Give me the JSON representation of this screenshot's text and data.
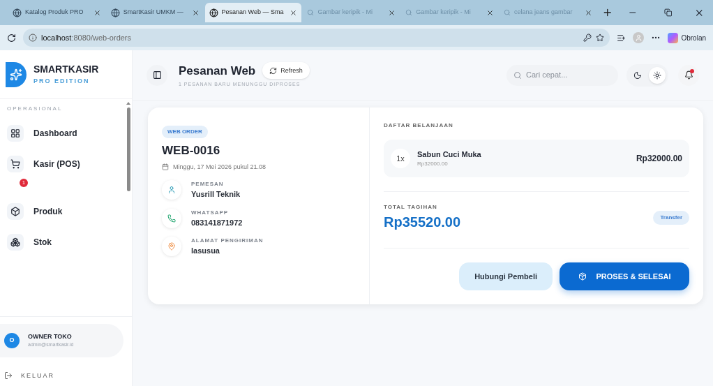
{
  "browser": {
    "tabs": [
      {
        "title": "Katalog Produk PRO",
        "selected": false,
        "kind": "globe"
      },
      {
        "title": "SmartKasir UMKM —",
        "selected": false,
        "kind": "globe"
      },
      {
        "title": "Pesanan Web — Sma",
        "selected": true,
        "kind": "globe"
      },
      {
        "title": "Gambar keripik - Mi",
        "selected": false,
        "kind": "search"
      },
      {
        "title": "Gambar keripik - Mi",
        "selected": false,
        "kind": "search"
      },
      {
        "title": "celana jeans gambar",
        "selected": false,
        "kind": "search"
      }
    ],
    "address_host": "localhost",
    "address_rest": ":8080/web-orders",
    "copilot_label": "Obrolan"
  },
  "sidebar": {
    "brand": "SMARTKASIR",
    "edition": "PRO EDITION",
    "section": "OPERASIONAL",
    "items": [
      {
        "label": "Dashboard"
      },
      {
        "label": "Kasir (POS)",
        "badge": "1"
      },
      {
        "label": "Produk"
      },
      {
        "label": "Stok"
      }
    ],
    "user": {
      "initial": "O",
      "name": "OWNER TOKO",
      "email": "admin@smartkasir.id"
    },
    "logout": "KELUAR"
  },
  "header": {
    "title": "Pesanan Web",
    "refresh": "Refresh",
    "subtitle": "1 PESANAN BARU MENUNGGU DIPROSES",
    "search_placeholder": "Cari cepat...",
    "theme_options": [
      {
        "kind": "dark",
        "selected": false
      },
      {
        "kind": "light",
        "selected": true
      }
    ],
    "notification_alert": true
  },
  "order": {
    "tag": "WEB ORDER",
    "id": "WEB-0016",
    "date": "Minggu, 17 Mei 2026 pukul 21.08",
    "fields": [
      {
        "label": "PEMESAN",
        "value": "Yusrill Teknik"
      },
      {
        "label": "WHATSAPP",
        "value": "083141871972"
      },
      {
        "label": "ALAMAT PENGIRIMAN",
        "value": "lasusua"
      }
    ],
    "list_title": "DAFTAR BELANJAAN",
    "items": [
      {
        "qty": "1x",
        "name": "Sabun Cuci Muka",
        "unit_price": "Rp32000.00",
        "total": "Rp32000.00"
      }
    ],
    "total_label": "TOTAL TAGIHAN",
    "total": "Rp35520.00",
    "payment": "Transfer",
    "contact_button": "Hubungi Pembeli",
    "process_button": "PROSES & SELESAI"
  }
}
